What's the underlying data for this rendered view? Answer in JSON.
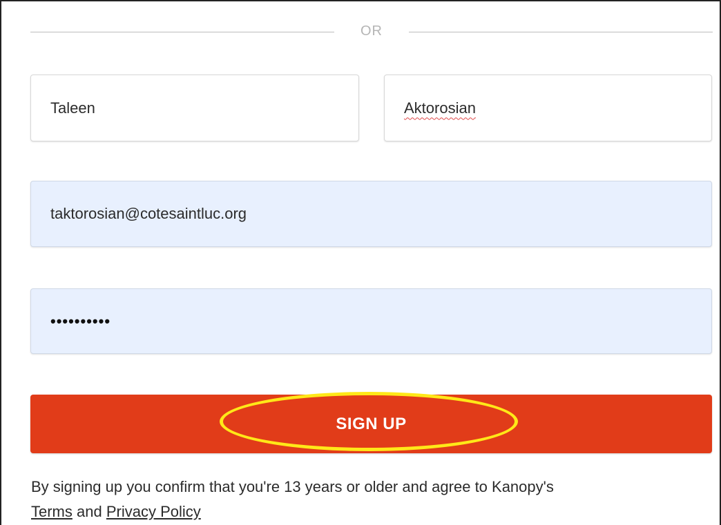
{
  "divider": {
    "label": "OR"
  },
  "form": {
    "first_name": "Taleen",
    "last_name": "Aktorosian",
    "email": "taktorosian@cotesaintluc.org",
    "password_masked": "••••••••••"
  },
  "signup_button": {
    "label": "SIGN UP"
  },
  "legal": {
    "text": "By signing up you confirm that you're 13 years or older and agree to Kanopy's",
    "terms_link": "Terms",
    "and_text": "and",
    "privacy_link": "Privacy Policy"
  },
  "colors": {
    "button": "#e13c19",
    "autofill_bg": "#e8f0fe",
    "highlight_ring": "#ffe818"
  }
}
